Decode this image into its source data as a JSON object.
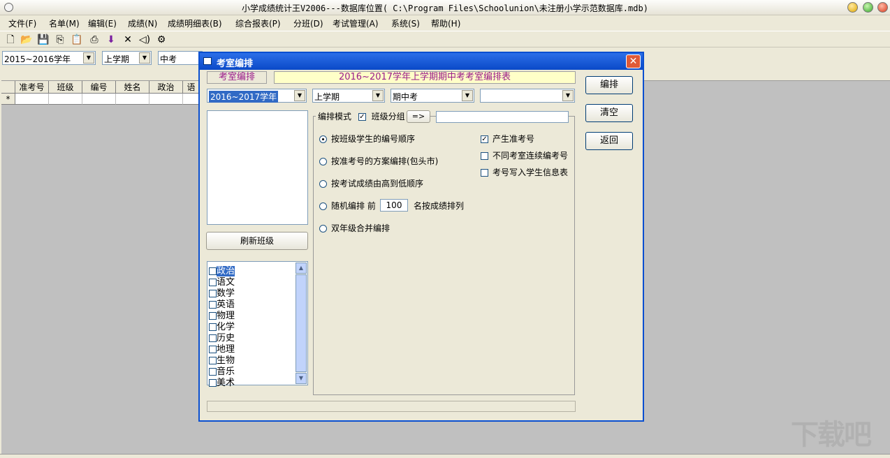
{
  "window": {
    "title": "小学成绩统计王V2006---数据库位置( C:\\Program Files\\Schoolunion\\未注册小学示范数据库.mdb)"
  },
  "menu": [
    {
      "label": "文件(F)"
    },
    {
      "label": "名单(M)"
    },
    {
      "label": "编辑(E)"
    },
    {
      "label": "成绩(N)"
    },
    {
      "label": "成绩明细表(B)"
    },
    {
      "label": "综合报表(P)"
    },
    {
      "label": "分班(D)"
    },
    {
      "label": "考试管理(A)"
    },
    {
      "label": "系统(S)"
    },
    {
      "label": "帮助(H)"
    }
  ],
  "toolbar": {
    "icons": [
      "new-file-icon",
      "open-folder-icon",
      "save-icon",
      "copy-icon",
      "paste-icon",
      "print-icon",
      "import-icon",
      "delete-icon",
      "audio-icon",
      "settings-icon"
    ]
  },
  "filters": {
    "year": "2015~2016学年",
    "term": "上学期",
    "exam": "中考"
  },
  "grid": {
    "columns": [
      "准考号",
      "班级",
      "编号",
      "姓名",
      "政治",
      "语"
    ],
    "new_row_marker": "*"
  },
  "dialog": {
    "title": "考室编排",
    "tab_label": "考室编排",
    "header_title": "2016~2017学年上学期期中考考室编排表",
    "year": "2016~2017学年",
    "term": "上学期",
    "exam": "期中考",
    "extra_combo": "",
    "refresh_button": "刷新班级",
    "mode_label": "编排模式",
    "group_by_class_label": "班级分组",
    "group_by_class_checked": true,
    "arrow_button": "=>",
    "arrow_field": "",
    "options": [
      {
        "label": "按班级学生的编号顺序",
        "selected": true
      },
      {
        "label": "按准考号的方案编排(包头市)",
        "selected": false
      },
      {
        "label": "按考试成绩由高到低顺序",
        "selected": false
      },
      {
        "label": "随机编排 前",
        "selected": false
      },
      {
        "label": "双年级合并编排",
        "selected": false
      }
    ],
    "random_count": "100",
    "random_suffix": "名按成绩排列",
    "checks": [
      {
        "label": "产生准考号",
        "checked": true
      },
      {
        "label": "不同考室连续编考号",
        "checked": false
      },
      {
        "label": "考号写入学生信息表",
        "checked": false
      }
    ],
    "buttons": {
      "arrange": "编排",
      "clear": "清空",
      "back": "返回"
    },
    "subjects": [
      {
        "name": "政治",
        "checked": false,
        "selected": true
      },
      {
        "name": "语文",
        "checked": false
      },
      {
        "name": "数学",
        "checked": false
      },
      {
        "name": "英语",
        "checked": false
      },
      {
        "name": "物理",
        "checked": false
      },
      {
        "name": "化学",
        "checked": false
      },
      {
        "name": "历史",
        "checked": false
      },
      {
        "name": "地理",
        "checked": false
      },
      {
        "name": "生物",
        "checked": false
      },
      {
        "name": "音乐",
        "checked": false
      },
      {
        "name": "美术",
        "checked": false
      }
    ]
  },
  "watermark": "下载吧"
}
